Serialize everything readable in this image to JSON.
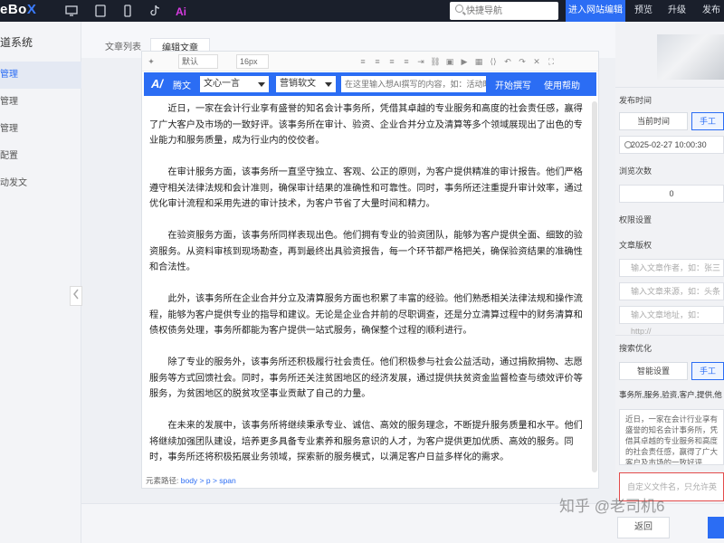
{
  "topbar": {
    "logo_main": "eBo",
    "logo_x": "X",
    "search_placeholder": "快捷导航",
    "enter_editor": "进入网站编辑",
    "preview": "预览",
    "upgrade": "升级",
    "publish": "发布",
    "icons": [
      "monitor-icon",
      "tablet-icon",
      "phone-icon",
      "tiktok-icon",
      "ai-icon"
    ]
  },
  "sidebar": {
    "title": "道系统",
    "items": [
      {
        "label": "管理",
        "active": true
      },
      {
        "label": "管理",
        "active": false
      },
      {
        "label": "管理",
        "active": false
      },
      {
        "label": "配置",
        "active": false
      },
      {
        "label": "动发文",
        "active": false
      }
    ]
  },
  "tabs": [
    {
      "label": "文章列表",
      "active": false
    },
    {
      "label": "编辑文章",
      "active": true
    }
  ],
  "editor": {
    "font_select": "默认",
    "size_select": "16px",
    "ai_label": "腾文",
    "ai_model": "文心一言",
    "ai_style": "营销软文",
    "ai_input_placeholder": "在这里输入想AI撰写的内容，如：活动时",
    "ai_start": "开始撰写",
    "ai_help": "使用帮助",
    "paragraphs": [
      "近日，一家在会计行业享有盛誉的知名会计事务所，凭借其卓越的专业服务和高度的社会责任感，赢得了广大客户及市场的一致好评。该事务所在审计、验资、企业合并分立及清算等多个领域展现出了出色的专业能力和服务质量，成为行业内的佼佼者。",
      "在审计服务方面，该事务所一直坚守独立、客观、公正的原则，为客户提供精准的审计报告。他们严格遵守相关法律法规和会计准则，确保审计结果的准确性和可靠性。同时，事务所还注重提升审计效率，通过优化审计流程和采用先进的审计技术，为客户节省了大量时间和精力。",
      "在验资服务方面，该事务所同样表现出色。他们拥有专业的验资团队，能够为客户提供全面、细致的验资服务。从资料审核到现场勘查，再到最终出具验资报告，每一个环节都严格把关，确保验资结果的准确性和合法性。",
      "此外，该事务所在企业合并分立及清算服务方面也积累了丰富的经验。他们熟悉相关法律法规和操作流程，能够为客户提供专业的指导和建议。无论是企业合并前的尽职调查，还是分立清算过程中的财务清算和债权债务处理，事务所都能为客户提供一站式服务，确保整个过程的顺利进行。",
      "除了专业的服务外，该事务所还积极履行社会责任。他们积极参与社会公益活动，通过捐款捐物、志愿服务等方式回馈社会。同时，事务所还关注贫困地区的经济发展，通过提供扶贫资金监督检查与绩效评价等服务，为贫困地区的脱贫攻坚事业贡献了自己的力量。",
      "在未来的发展中，该事务所将继续秉承专业、诚信、高效的服务理念，不断提升服务质量和水平。他们将继续加强团队建设，培养更多具备专业素养和服务意识的人才，为客户提供更加优质、高效的服务。同时，事务所还将积极拓展业务领域，探索新的服务模式，以满足客户日益多样化的需求。"
    ],
    "path_label": "元素路径:",
    "path_value": "body > p > span"
  },
  "right_panel": {
    "publish_time_label": "发布时间",
    "current_time": "当前时间",
    "manual": "手工",
    "datetime": "2025-02-27 10:00:30",
    "views_label": "浏览次数",
    "views_value": "0",
    "permission_label": "权限设置",
    "copyright_label": "文章版权",
    "author_placeholder": "输入文章作者，如：张三",
    "source_placeholder": "输入文章来源，如：头条",
    "url_placeholder": "输入文章地址，如：http://",
    "seo_label": "搜索优化",
    "smart_setting": "智能设置",
    "manual2": "手工",
    "keywords": "事务所,服务,验资,客户,提供,他",
    "description": "近日，一家在会计行业享有盛誉的知名会计事务所，凭借其卓越的专业服务和高度的社会责任感，赢得了广大客户及市场的一致好评",
    "filename_placeholder": "自定义文件名，只允许英文+数"
  },
  "bottom": {
    "back": "返回"
  },
  "watermark": "知乎 @老司机6",
  "colors": {
    "accent": "#2b6df4",
    "topbar": "#1a1f2b",
    "error": "#e34b4b"
  }
}
